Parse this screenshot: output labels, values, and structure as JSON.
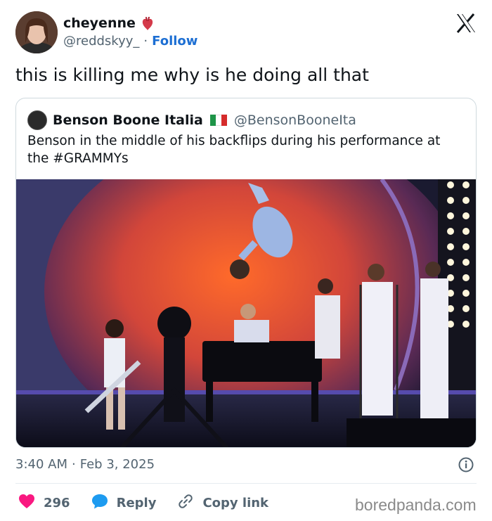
{
  "author": {
    "display_name": "cheyenne",
    "name_emoji": "anatomical-heart-icon",
    "handle": "@reddskyy_",
    "separator": "·",
    "follow_label": "Follow"
  },
  "tweet": {
    "text": "this is killing me why is he doing all that"
  },
  "quoted": {
    "display_name": "Benson Boone Italia",
    "flag": "italy-flag-icon",
    "handle": "@BensonBooneIta",
    "text": "Benson in the middle of his backflips during his performance at the #GRAMMYs",
    "image": "stage-performance-photo"
  },
  "meta": {
    "time": "3:40 AM",
    "separator": "·",
    "date": "Feb 3, 2025"
  },
  "actions": {
    "like_count": "296",
    "reply_label": "Reply",
    "copy_link_label": "Copy link"
  },
  "watermark": "boredpanda.com",
  "colors": {
    "like": "#f91880",
    "reply": "#1d9bf0",
    "follow": "#1d6fd3",
    "secondary_text": "#536471"
  }
}
